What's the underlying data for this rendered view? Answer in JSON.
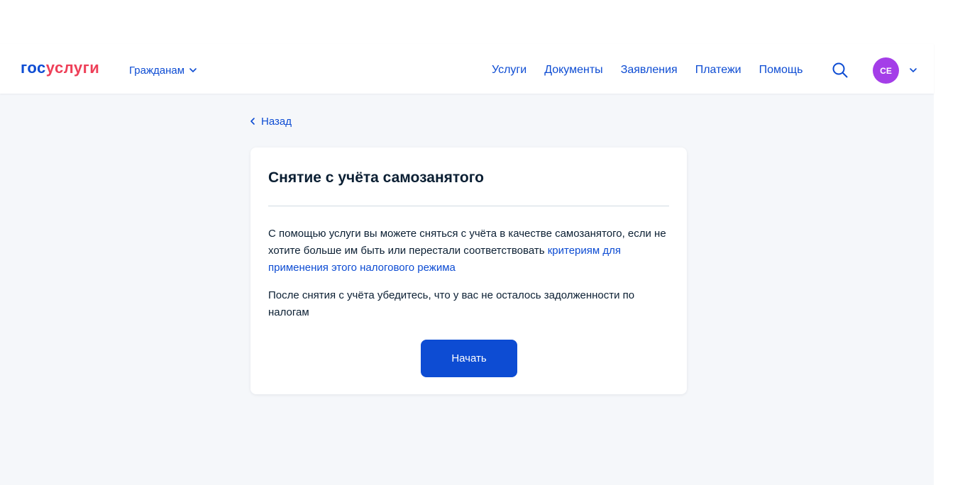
{
  "colors": {
    "accent": "#0d4cd3",
    "logo_part2": "#ee3f58",
    "avatar_bg": "#a43ee8",
    "page_bg": "#f5f7fa"
  },
  "header": {
    "logo": {
      "part1": "гос",
      "part2": "услуги"
    },
    "role_menu": {
      "label": "Гражданам",
      "icon": "chevron-down-icon"
    },
    "nav": [
      "Услуги",
      "Документы",
      "Заявления",
      "Платежи",
      "Помощь"
    ],
    "search_icon": "search-icon",
    "avatar_initials": "СЕ",
    "avatar_menu_icon": "chevron-down-icon"
  },
  "back": {
    "label": "Назад",
    "icon": "chevron-left-icon"
  },
  "card": {
    "title": "Снятие с учёта самозанятого",
    "paragraph1_text": "С помощью услуги вы можете сняться с учёта в качестве самозанятого, если не хотите больше им быть или перестали соответствовать ",
    "paragraph1_link": "критериям для применения этого налогового режима",
    "paragraph2": "После снятия с учёта убедитесь, что у вас не осталось задолженности по налогам",
    "button": "Начать"
  }
}
